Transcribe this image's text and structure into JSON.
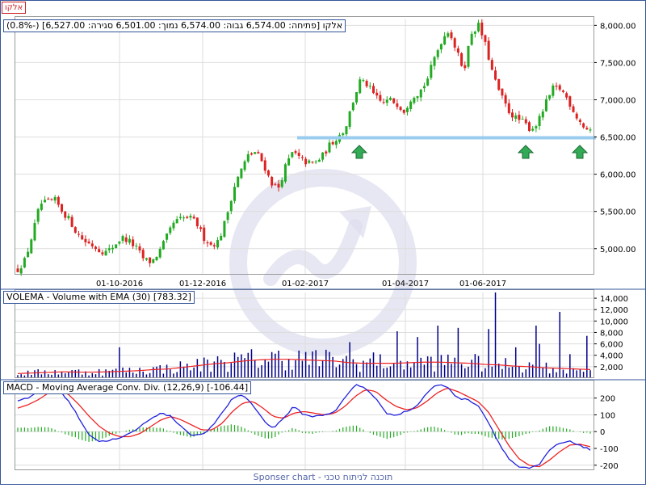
{
  "symbol_tag": "אלקו",
  "price_info": "אלקו [פתיחה: 6,574.00  גבוה: 6,574.00  נמוך: 6,501.00  סגירה: 6,527.00] (-0.8%)",
  "volume_info": "VOLEMA - Volume with EMA (30) [783.32]",
  "macd_info": "MACD - Moving Average Conv. Div. (12,26,9) [-106.44]",
  "footer": "Sponser chart - תוכנה לניתוח טכני",
  "colors": {
    "up_candle": "#22aa22",
    "down_candle": "#dd2222",
    "volume_bar": "#000088",
    "ema_line": "#ee2222",
    "macd_line": "#2222dd",
    "signal_line": "#ee2222",
    "histogram": "#22aa22",
    "support_line": "#99ccee",
    "arrow": "#33aa55",
    "grid": "#dddddd",
    "watermark": "#ddddee"
  },
  "chart_data": [
    {
      "type": "candlestick",
      "x_ticks": [
        "01-10-2016",
        "01-12-2016",
        "01-02-2017",
        "01-04-2017",
        "01-06-2017"
      ],
      "y_ticks": [
        "5,000.00",
        "5,500.00",
        "6,000.00",
        "6,500.00",
        "7,000.00",
        "7,500.00",
        "8,000.00"
      ],
      "ylim": [
        4650,
        8080
      ],
      "support_level": 6490,
      "signal_arrows": [
        "up",
        "up",
        "up"
      ],
      "close_path": [
        4720,
        4850,
        5200,
        5600,
        5620,
        5650,
        5500,
        5380,
        5200,
        5100,
        5050,
        4980,
        4950,
        5050,
        5150,
        5100,
        5000,
        4850,
        4820,
        4950,
        5150,
        5350,
        5400,
        5420,
        5350,
        5150,
        5050,
        5100,
        5400,
        5800,
        6050,
        6250,
        6300,
        6150,
        5900,
        5800,
        6100,
        6300,
        6200,
        6150,
        6150,
        6250,
        6400,
        6500,
        6600,
        6950,
        7250,
        7200,
        7050,
        6950,
        7000,
        6950,
        6850,
        7050,
        7100,
        7250,
        7550,
        7800,
        7950,
        7650,
        7400,
        7900,
        8000,
        7700,
        7300,
        7050,
        6850,
        6750,
        6700,
        6600,
        6700,
        6950,
        7150,
        7150,
        7000,
        6800,
        6650,
        6560
      ]
    },
    {
      "type": "bar",
      "series": [
        {
          "name": "VOLEMA"
        },
        {
          "name": "EMA (30)"
        }
      ],
      "y_ticks": [
        "2,000",
        "4,000",
        "6,000",
        "8,000",
        "10,000",
        "12,000",
        "14,000"
      ],
      "ylim": [
        0,
        15000
      ],
      "ema_path": [
        800,
        900,
        1000,
        1100,
        1050,
        1050,
        1100,
        1200,
        1300,
        1500,
        1600,
        1900,
        2200,
        2500,
        2700,
        3000,
        3200,
        3300,
        3300,
        3200,
        3100,
        3000,
        2700,
        2600,
        2600,
        2600,
        2700,
        2800,
        2800,
        2700,
        2600,
        2400,
        2300,
        2100,
        2000,
        1800,
        1700,
        1600,
        1500
      ]
    },
    {
      "type": "line",
      "series": [
        {
          "name": "MACD"
        },
        {
          "name": "Signal"
        },
        {
          "name": "Histogram"
        }
      ],
      "y_ticks": [
        "-200",
        "-100",
        "0",
        "100",
        "200"
      ],
      "ylim": [
        -230,
        290
      ],
      "macd_path": [
        180,
        200,
        240,
        280,
        250,
        180,
        80,
        -20,
        -60,
        -50,
        -40,
        -10,
        30,
        80,
        110,
        90,
        30,
        -20,
        -20,
        30,
        110,
        200,
        220,
        160,
        70,
        20,
        80,
        150,
        100,
        90,
        100,
        120,
        200,
        280,
        260,
        200,
        110,
        100,
        120,
        150,
        230,
        280,
        270,
        200,
        190,
        160,
        60,
        -60,
        -160,
        -210,
        -220,
        -200,
        -110,
        -70,
        -60,
        -80,
        -110
      ],
      "signal_path": [
        140,
        160,
        190,
        230,
        250,
        220,
        160,
        90,
        30,
        -10,
        -30,
        -30,
        -10,
        30,
        70,
        90,
        70,
        40,
        10,
        10,
        50,
        120,
        170,
        180,
        140,
        90,
        80,
        110,
        120,
        110,
        100,
        110,
        150,
        210,
        250,
        240,
        190,
        150,
        130,
        140,
        180,
        230,
        260,
        240,
        210,
        180,
        120,
        20,
        -80,
        -160,
        -200,
        -210,
        -170,
        -120,
        -80,
        -75,
        -90
      ]
    }
  ]
}
